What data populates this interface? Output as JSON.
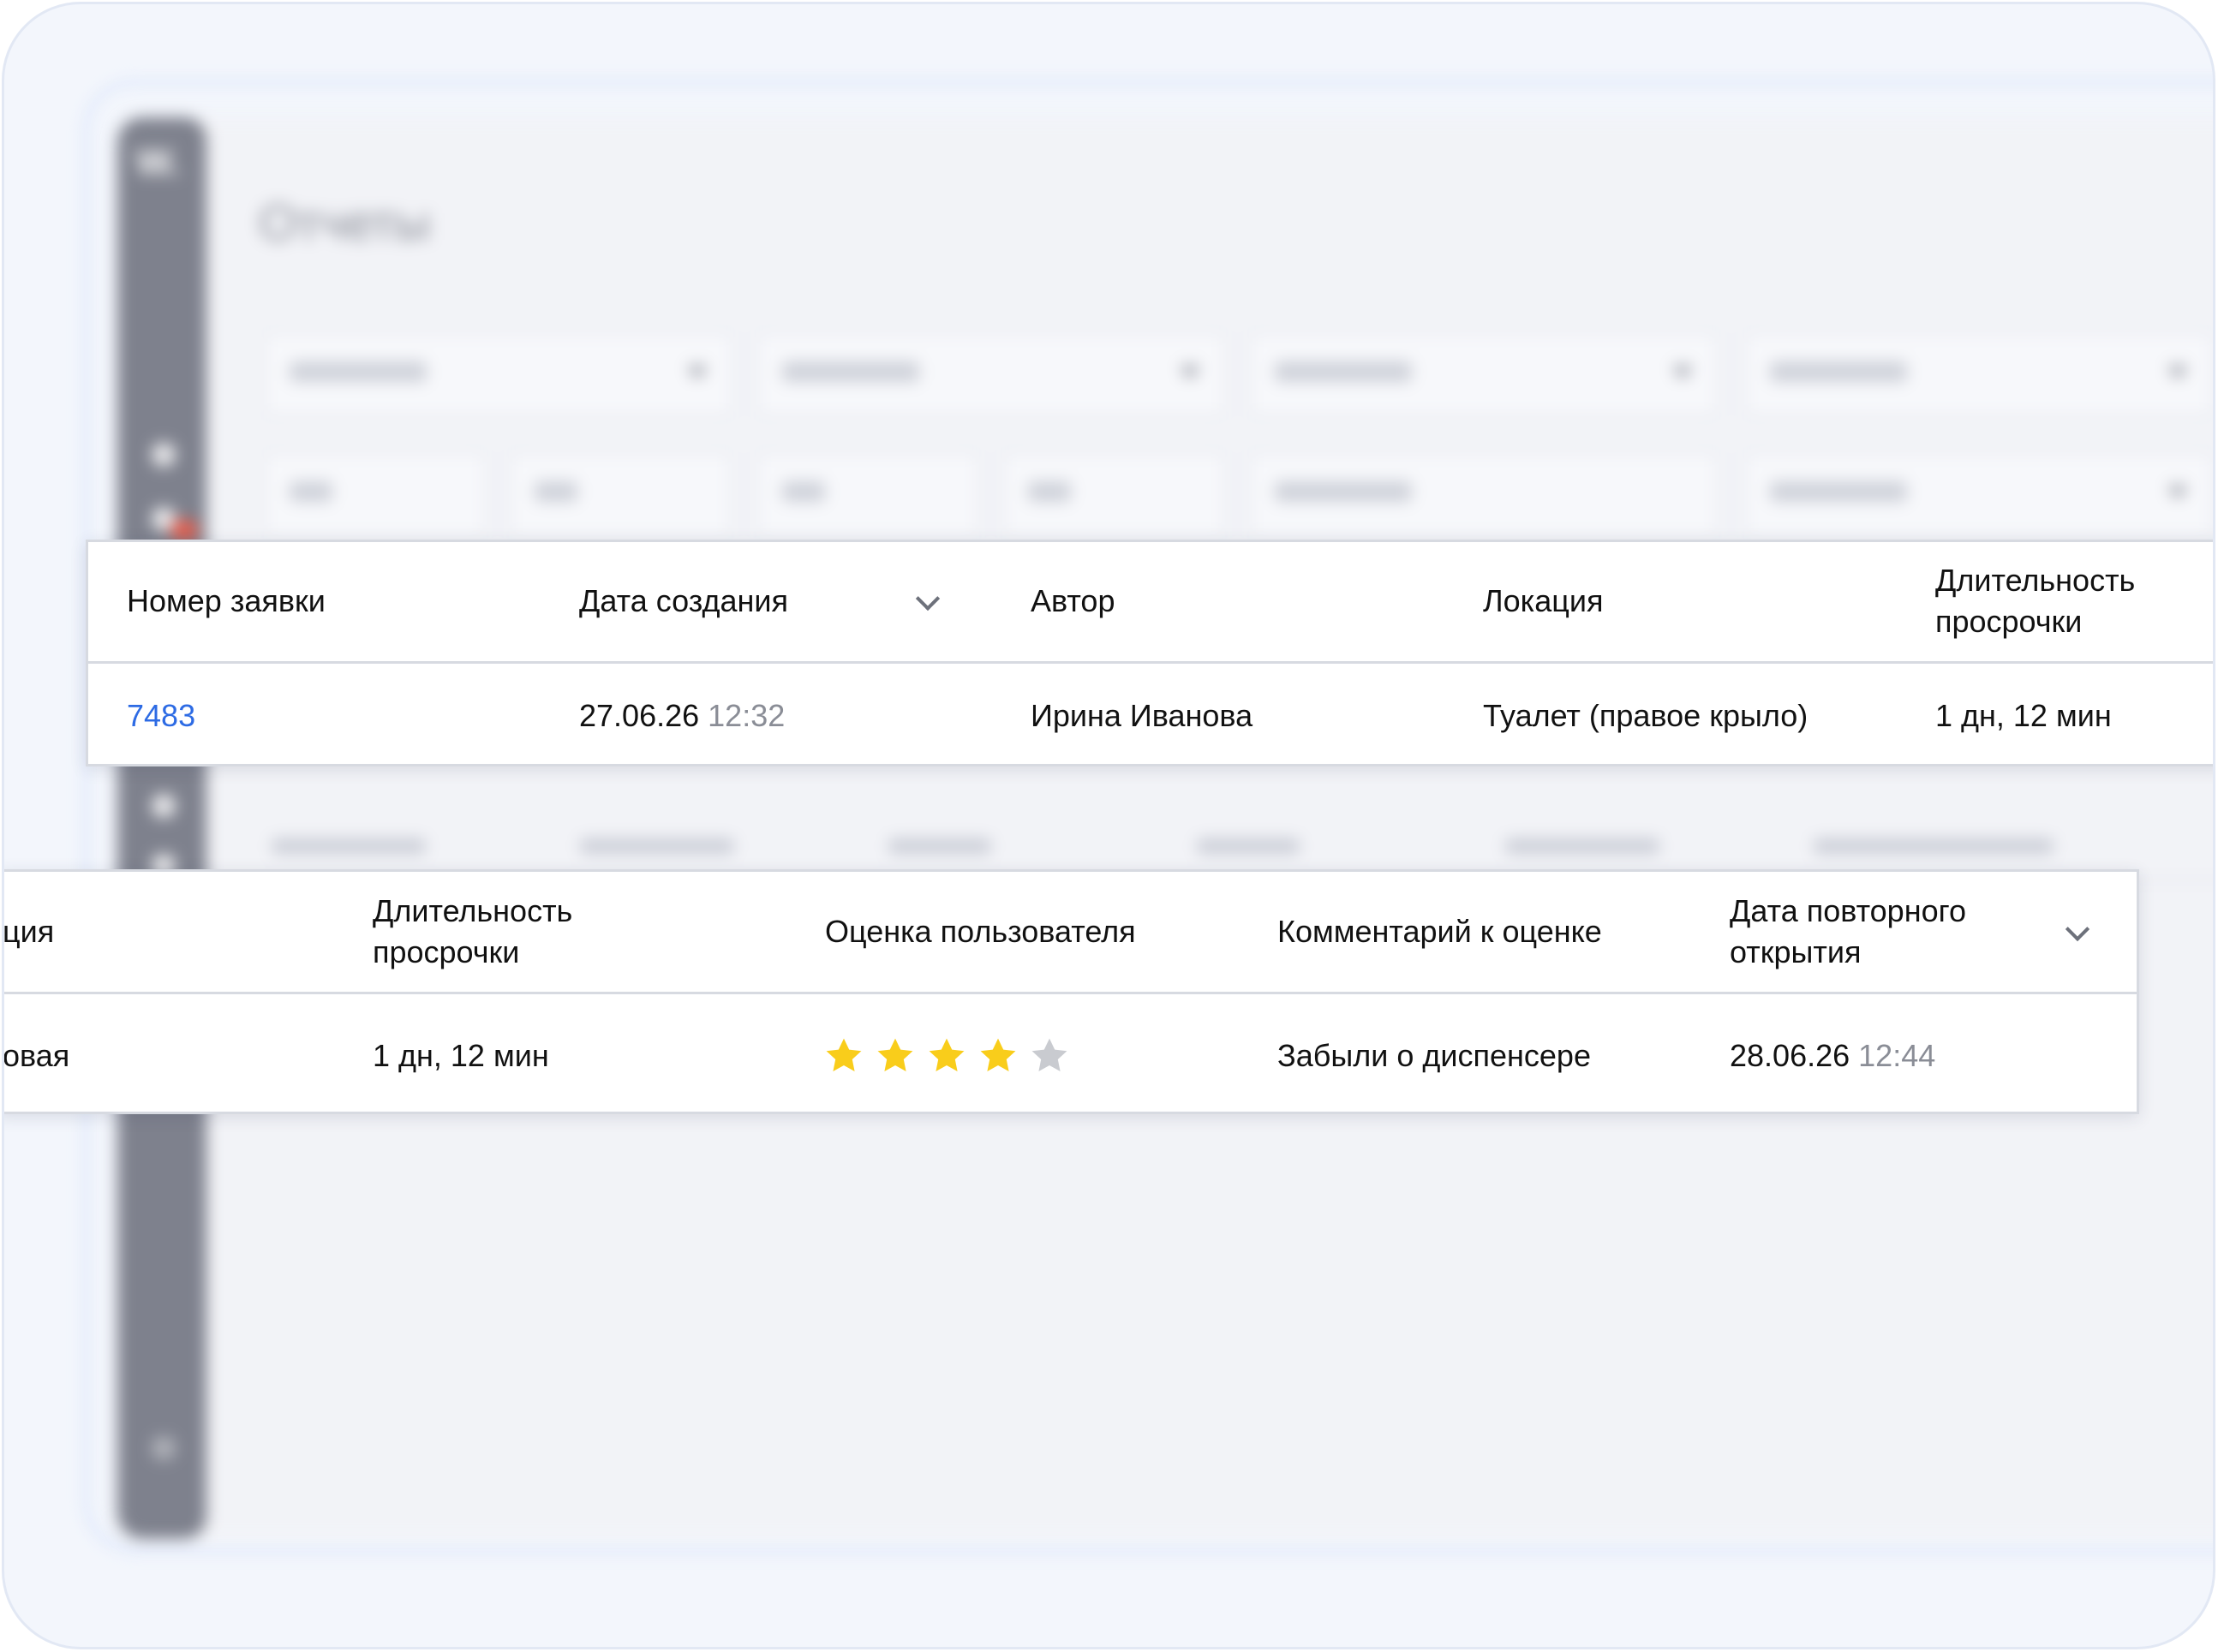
{
  "page": {
    "title": "Отчеты"
  },
  "card_top": {
    "headers": {
      "request_number": "Номер заявки",
      "created_date": "Дата создания",
      "author": "Автор",
      "location": "Локация",
      "overdue_line1": "Длительность",
      "overdue_line2": "просрочки"
    },
    "row": {
      "request_number": "7483",
      "created_date": "27.06.26",
      "created_time": "12:32",
      "author": "Ирина Иванова",
      "location": "Туалет (правое крыло)",
      "overdue": "1 дн, 12 мин"
    }
  },
  "card_bottom": {
    "headers": {
      "location_cut": "ция",
      "overdue_line1": "Длительность",
      "overdue_line2": "просрочки",
      "rating": "Оценка пользователя",
      "comment": "Комментарий к оценке",
      "reopen_line1": "Дата повторного",
      "reopen_line2": "открытия"
    },
    "row": {
      "location_cut": "овая",
      "overdue": "1 дн, 12 мин",
      "rating": {
        "value": 4,
        "max": 5
      },
      "comment": "Забыли о диспенсере",
      "reopen_date": "28.06.26",
      "reopen_time": "12:44"
    }
  },
  "colors": {
    "link": "#2d6be4",
    "star_filled": "#f9cd1b",
    "star_empty": "#c9cbd0",
    "muted_text": "#8a8d96"
  },
  "icons": {
    "sort": "chevron-down-icon",
    "star_filled": "star-filled-icon",
    "star_empty": "star-empty-icon"
  }
}
